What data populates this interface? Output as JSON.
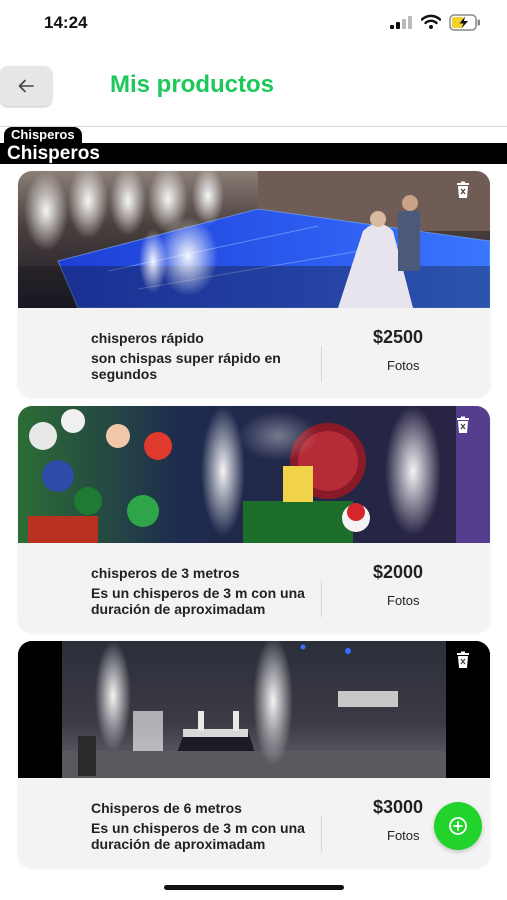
{
  "status_bar": {
    "time": "14:24"
  },
  "header": {
    "title": "Mis productos"
  },
  "category": {
    "tab_label": "Chisperos",
    "bar_label": "Chisperos"
  },
  "products": [
    {
      "name": "chisperos rápido",
      "description": "son chispas super rápido en segundos",
      "price": "$2500",
      "photos_label": "Fotos"
    },
    {
      "name": "chisperos de 3 metros",
      "description": "Es un chisperos de 3 m con una duración de aproximadam",
      "price": "$2000",
      "photos_label": "Fotos"
    },
    {
      "name": "Chisperos de 6 metros",
      "description": "Es un chisperos de 3 m con una duración de aproximadam",
      "price": "$3000",
      "photos_label": "Fotos"
    }
  ],
  "icons": {
    "back": "arrow-left-icon",
    "delete": "trash-icon",
    "add": "plus-circle-icon"
  },
  "colors": {
    "accent": "#1dc85a",
    "fab": "#21d32a",
    "category_bar": "#000000"
  }
}
